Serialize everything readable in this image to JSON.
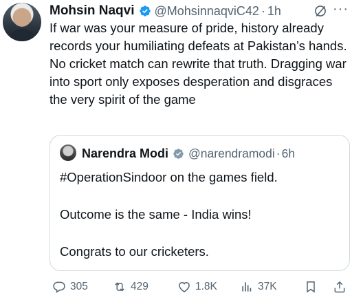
{
  "tweet": {
    "author_name": "Mohsin Naqvi",
    "handle": "@MohsinnaqviC42",
    "separator": "·",
    "time": "1h",
    "more": "···",
    "text": "If war was your measure of pride, history already records your humiliating defeats at Pakistan’s hands. No cricket match can rewrite that truth. Dragging war into sport only exposes desperation and disgraces the very spirit of the game"
  },
  "quoted": {
    "author_name": "Narendra Modi",
    "handle": "@narendramodi",
    "separator": "·",
    "time": "6h",
    "line1": "#OperationSindoor on the games field.",
    "line2": "Outcome is the same - India wins!",
    "line3": "Congrats to our cricketers."
  },
  "actions": {
    "replies": "305",
    "reposts": "429",
    "likes": "1.8K",
    "views": "37K"
  },
  "colors": {
    "verified_blue": "#1d9bf0",
    "verified_gray": "#829aab",
    "secondary_text": "#536471",
    "border": "#cfd9de"
  }
}
